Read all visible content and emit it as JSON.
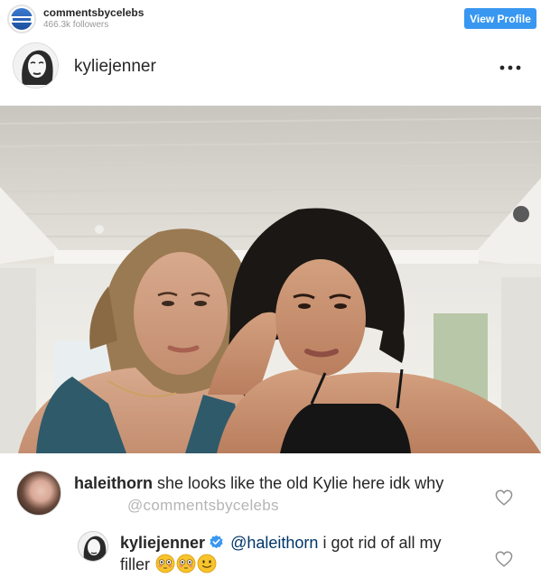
{
  "embed": {
    "account_name": "commentsbycelebs",
    "followers": "466.3k followers",
    "view_profile_label": "View Profile"
  },
  "post": {
    "username": "kyliejenner",
    "more_icon": "more-horizontal-icon"
  },
  "comments": [
    {
      "username": "haleithorn",
      "text": "she looks like the old Kylie here idk why"
    },
    {
      "username": "kyliejenner",
      "verified": true,
      "mention": "@haleithorn",
      "text": "i got rid of all my filler",
      "emojis": [
        "flushed-face-emoji",
        "flushed-face-emoji",
        "smiling-face-emoji"
      ]
    }
  ],
  "watermark": "@commentsbycelebs",
  "colors": {
    "button_blue": "#3897f0",
    "verified_blue": "#3897f0",
    "mention_blue": "#003569",
    "watermark_gray": "#b5b5b5"
  }
}
